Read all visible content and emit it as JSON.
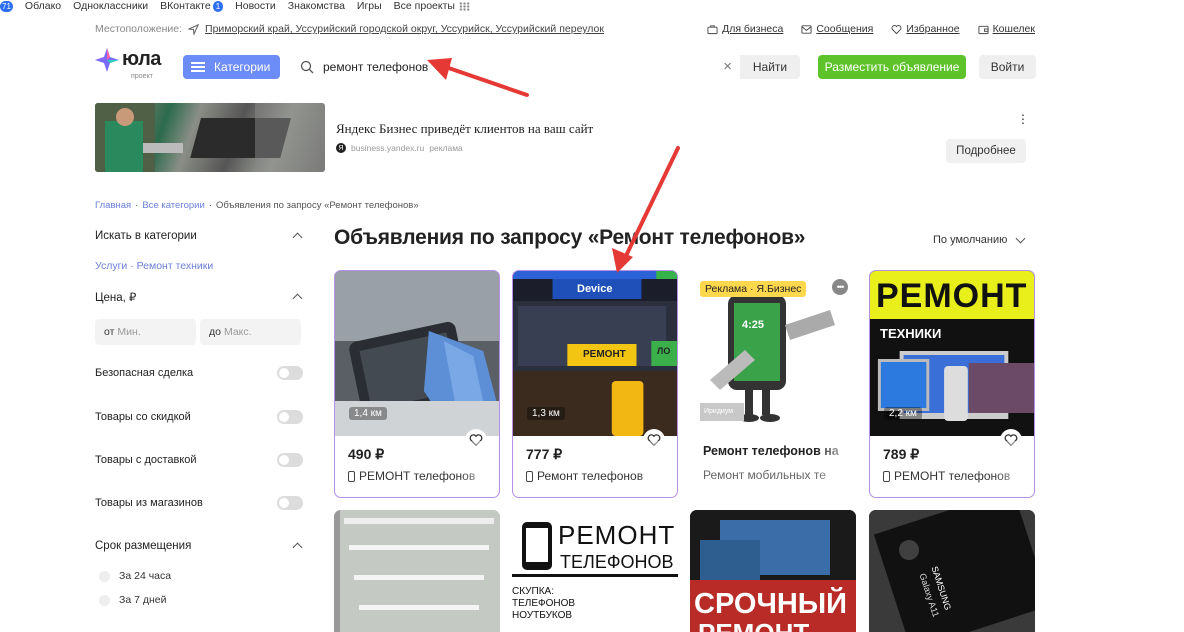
{
  "topbar": {
    "counter": "71",
    "links": [
      "Облако",
      "Одноклассники",
      "ВКонтакте",
      "Новости",
      "Знакомства",
      "Игры",
      "Все проекты"
    ],
    "vk_badge": "1"
  },
  "location": {
    "label": "Местоположение:",
    "value": "Приморский край, Уссурийский городской округ, Уссурийск, Уссурийский переулок"
  },
  "header_links": [
    "Для бизнеса",
    "Сообщения",
    "Избранное",
    "Кошелек"
  ],
  "logo": {
    "word": "юла",
    "sub": "проект"
  },
  "categories_label": "Категории",
  "search": {
    "value": "ремонт телефонов",
    "clear": "×",
    "button": "Найти"
  },
  "post_ad_label": "Разместить объявление",
  "login_label": "Войти",
  "ad": {
    "title": "Яндекс Бизнес приведёт клиентов на ваш сайт",
    "source": "business.yandex.ru",
    "tag": "реклама",
    "more": "Подробнее",
    "ya": "Я"
  },
  "breadcrumbs": [
    "Главная",
    "Все категории",
    "Объявления по запросу «Ремонт телефонов»"
  ],
  "sidebar": {
    "search_in_cat": "Искать в категории",
    "sub_link": "Услуги · Ремонт техники",
    "price_title": "Цена, ₽",
    "price_from": "от",
    "price_from_ph": "Мин.",
    "price_to": "до",
    "price_to_ph": "Макс.",
    "toggles": [
      "Безопасная сделка",
      "Товары со скидкой",
      "Товары с доставкой",
      "Товары из магазинов"
    ],
    "period_title": "Срок размещения",
    "periods": [
      "За 24 часа",
      "За 7 дней"
    ]
  },
  "page_title": "Объявления по запросу «Ремонт телефонов»",
  "sort_label": "По умолчанию",
  "cards": [
    {
      "price": "490 ₽",
      "title": "РЕМОНТ телефонов",
      "distance": "1,4 км"
    },
    {
      "price": "777 ₽",
      "title": "Ремонт телефонов",
      "distance": "1,3 км",
      "sign1": "Device",
      "sign2": "РЕМОНТ",
      "sign3": "ЛО"
    },
    {
      "badge": "Реклама · Я.Бизнес",
      "title": "Ремонт телефонов на",
      "desc": "Ремонт мобильных те",
      "clock": "4:25",
      "tag": "Иридиум"
    },
    {
      "price": "789 ₽",
      "title": "РЕМОНТ телефонов",
      "distance": "2,2 км",
      "img_big": "РЕМОНТ",
      "img_small": "ТЕХНИКИ"
    }
  ],
  "row2": {
    "c2_big": "РЕМОНТ",
    "c2_small": "ТЕЛЕФОНОВ",
    "c2_lines": [
      "СКУПКА:",
      "ТЕЛЕФОНОВ",
      "НОУТБУКОВ"
    ],
    "c3_text": "СРОЧНЫЙ",
    "c3_text2": "РЕМОНТ",
    "c4_text": "SAMSUNG",
    "c4_text2": "Galaxy A11"
  },
  "colors": {
    "accent": "#6c8cf7",
    "green": "#5ec32a",
    "arrow": "#e53935",
    "promo_border": "#b88fe6"
  }
}
